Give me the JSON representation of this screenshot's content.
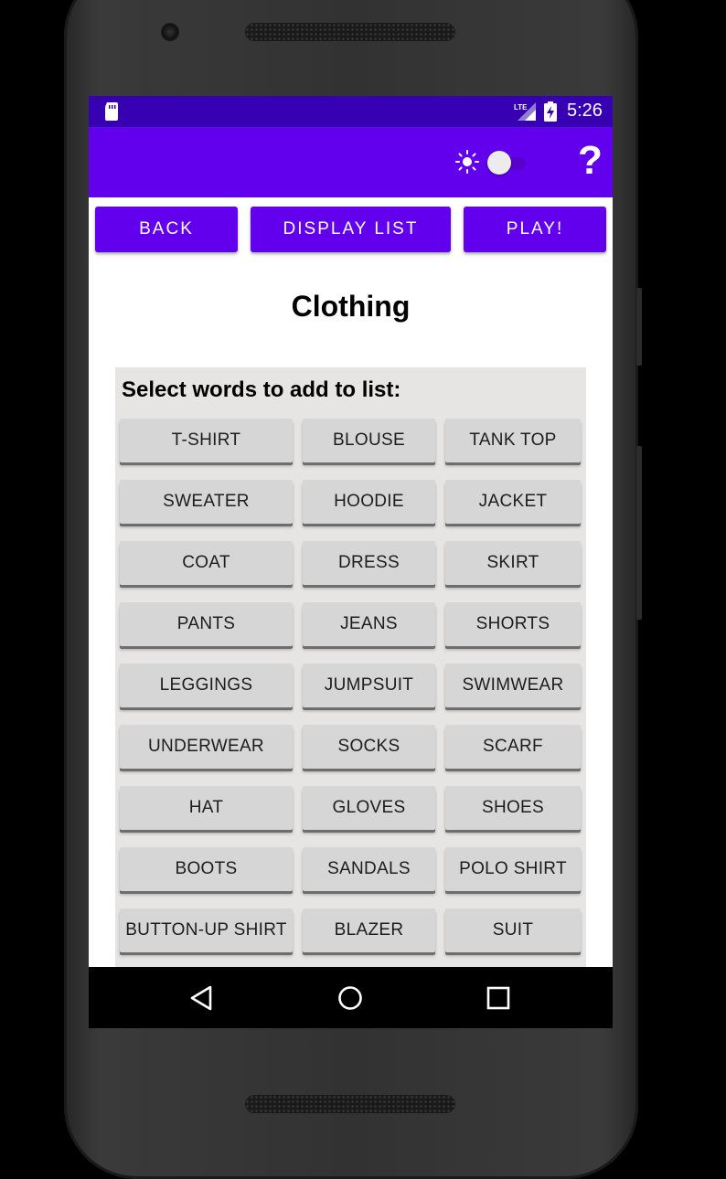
{
  "status_bar": {
    "time": "5:26",
    "network_label": "LTE",
    "icons": [
      "sd-card-icon",
      "lte-signal-icon",
      "battery-charging-icon"
    ]
  },
  "toolbar": {
    "icons": [
      "sun-icon",
      "theme-toggle",
      "moon-icon",
      "help-icon"
    ],
    "help_label": "?",
    "dark_mode_enabled": false
  },
  "nav_buttons": {
    "back": "BACK",
    "display_list": "DISPLAY LIST",
    "play": "PLAY!"
  },
  "page": {
    "title": "Clothing",
    "select_prompt": "Select words to add to list:"
  },
  "words": [
    [
      "T-SHIRT",
      "BLOUSE",
      "TANK TOP"
    ],
    [
      "SWEATER",
      "HOODIE",
      "JACKET"
    ],
    [
      "COAT",
      "DRESS",
      "SKIRT"
    ],
    [
      "PANTS",
      "JEANS",
      "SHORTS"
    ],
    [
      "LEGGINGS",
      "JUMPSUIT",
      "SWIMWEAR"
    ],
    [
      "UNDERWEAR",
      "SOCKS",
      "SCARF"
    ],
    [
      "HAT",
      "GLOVES",
      "SHOES"
    ],
    [
      "BOOTS",
      "SANDALS",
      "POLO SHIRT"
    ],
    [
      "BUTTON-UP SHIRT",
      "BLAZER",
      "SUIT"
    ]
  ],
  "system_nav": {
    "icons": [
      "back-triangle-icon",
      "home-circle-icon",
      "recents-square-icon"
    ]
  },
  "colors": {
    "status_bar": "#3700b3",
    "primary": "#6200ee",
    "word_button": "#d6d6d6",
    "panel_bg": "#e6e5e3"
  }
}
